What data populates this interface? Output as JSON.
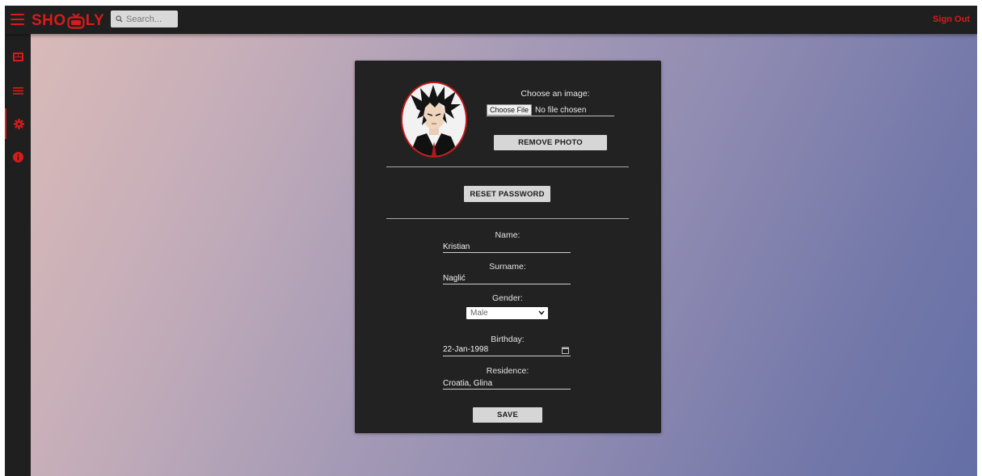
{
  "app": {
    "brand_before": "SHO",
    "brand_after": "LY"
  },
  "header": {
    "search_placeholder": "Search...",
    "sign_out": "Sign Out"
  },
  "colors": {
    "accent": "#d81b1b",
    "bar": "#1f1f1f",
    "card": "#222222"
  },
  "sidebar": {
    "items": [
      {
        "icon": "dashboard-icon"
      },
      {
        "icon": "list-icon"
      },
      {
        "icon": "settings-gear-icon",
        "active": true
      },
      {
        "icon": "info-icon"
      }
    ]
  },
  "profile": {
    "choose_image_label": "Choose an image:",
    "choose_file_button": "Choose File",
    "no_file_text": "No file chosen",
    "remove_photo": "REMOVE PHOTO",
    "reset_password": "RESET PASSWORD",
    "name_label": "Name:",
    "name_value": "Kristian",
    "surname_label": "Surname:",
    "surname_value": "Naglić",
    "gender_label": "Gender:",
    "gender_value": "Male",
    "birthday_label": "Birthday:",
    "birthday_value": "22-Jan-1998",
    "residence_label": "Residence:",
    "residence_value": "Croatia, Glina",
    "save": "SAVE"
  }
}
